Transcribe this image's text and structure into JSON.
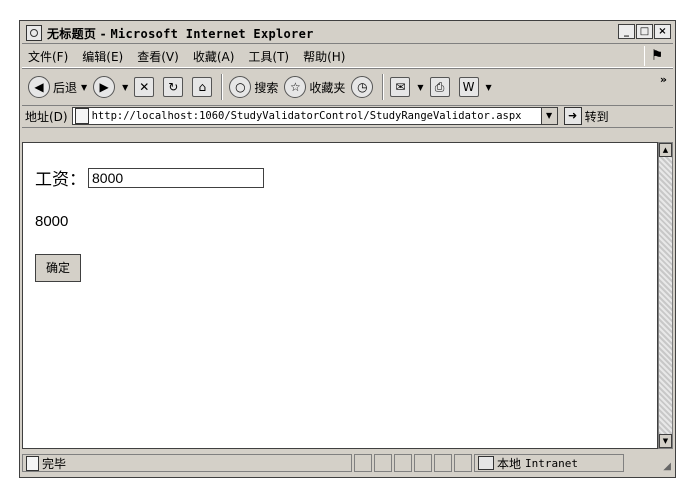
{
  "window": {
    "title_cn": "无标题页",
    "title_sep": " - ",
    "title_app": "Microsoft Internet Explorer",
    "btn_minimize": "_",
    "btn_maximize": "□",
    "btn_close": "×"
  },
  "menubar": [
    "文件(F)",
    "编辑(E)",
    "查看(V)",
    "收藏(A)",
    "工具(T)",
    "帮助(H)"
  ],
  "toolbar": {
    "back": "后退",
    "search": "搜索",
    "favorites": "收藏夹",
    "more": "»"
  },
  "address": {
    "label": "地址(D)",
    "url": "http://localhost:1060/StudyValidatorControl/StudyRangeValidator.aspx",
    "go": "转到"
  },
  "form": {
    "salary_label": "工资：",
    "salary_value": "8000",
    "echo_value": "8000",
    "ok_button": "确定"
  },
  "status": {
    "text": "完毕",
    "zone": "本地",
    "zone_en": "Intranet"
  }
}
